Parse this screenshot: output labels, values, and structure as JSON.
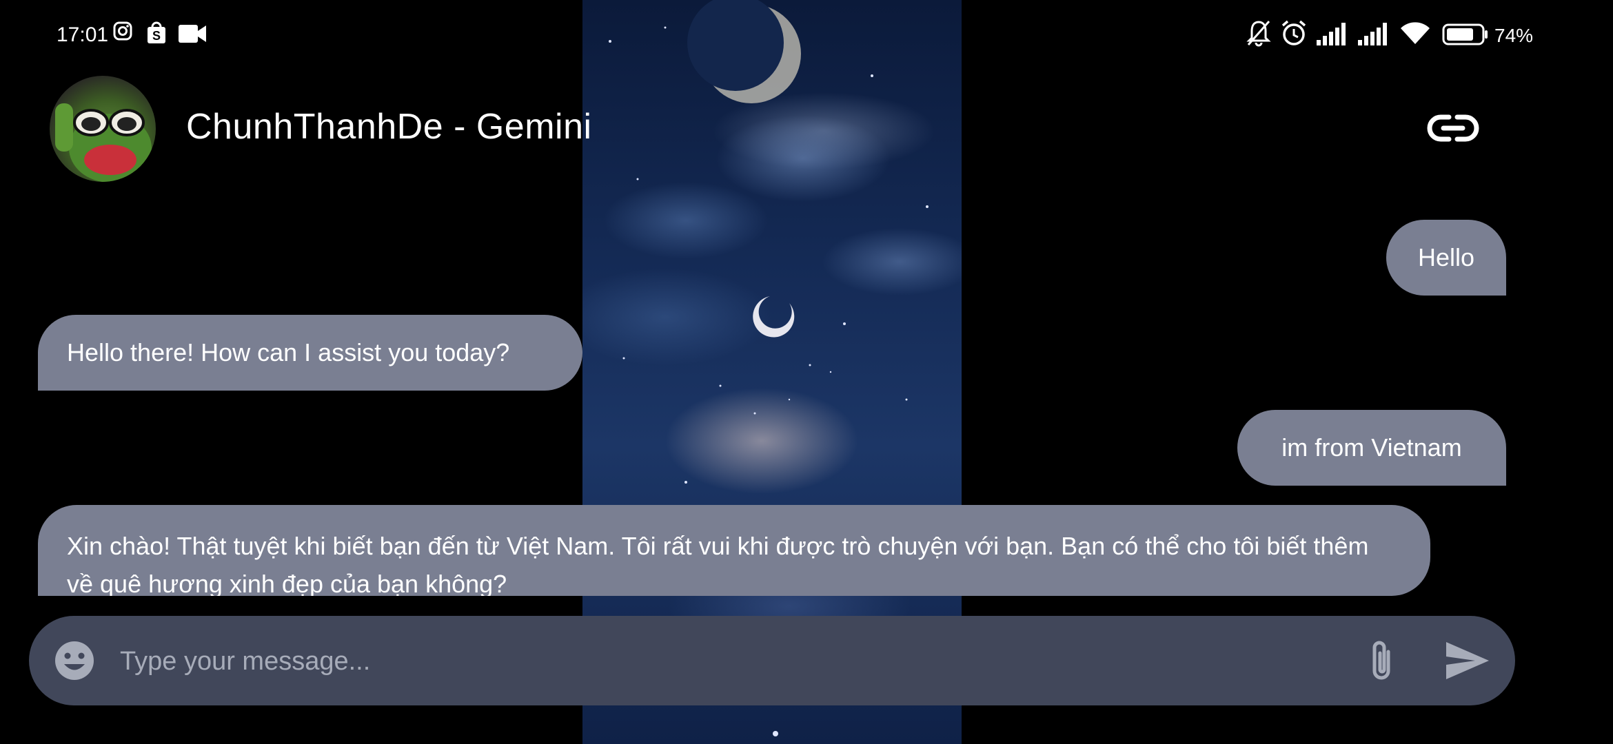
{
  "status_bar": {
    "time": "17:01",
    "battery_percent": "74%",
    "left_icons": [
      "instagram-icon",
      "shopee-icon",
      "video-camera-icon"
    ],
    "right_icons": [
      "bell-muted-icon",
      "alarm-icon",
      "signal-icon",
      "signal-icon",
      "wifi-icon",
      "battery-icon"
    ]
  },
  "header": {
    "title": "ChunhThanhDe - Gemini",
    "action_icon": "link-icon"
  },
  "messages": [
    {
      "from": "user",
      "text": "Hello"
    },
    {
      "from": "bot",
      "text": "Hello there! How can I assist you today?"
    },
    {
      "from": "user",
      "text": "im from Vietnam"
    },
    {
      "from": "bot",
      "text": "Xin chào! Thật tuyệt khi biết bạn đến từ Việt Nam. Tôi rất vui khi được trò chuyện với bạn. Bạn có thể cho tôi biết thêm về quê hương xinh đẹp của bạn không?"
    }
  ],
  "composer": {
    "placeholder": "Type your message...",
    "value": "",
    "icons": [
      "emoji-icon",
      "paperclip-icon",
      "send-icon"
    ]
  },
  "colors": {
    "background": "#000000",
    "bubble": "#7a7f92",
    "input_bar": "#41475a",
    "placeholder": "#a7acb9"
  }
}
